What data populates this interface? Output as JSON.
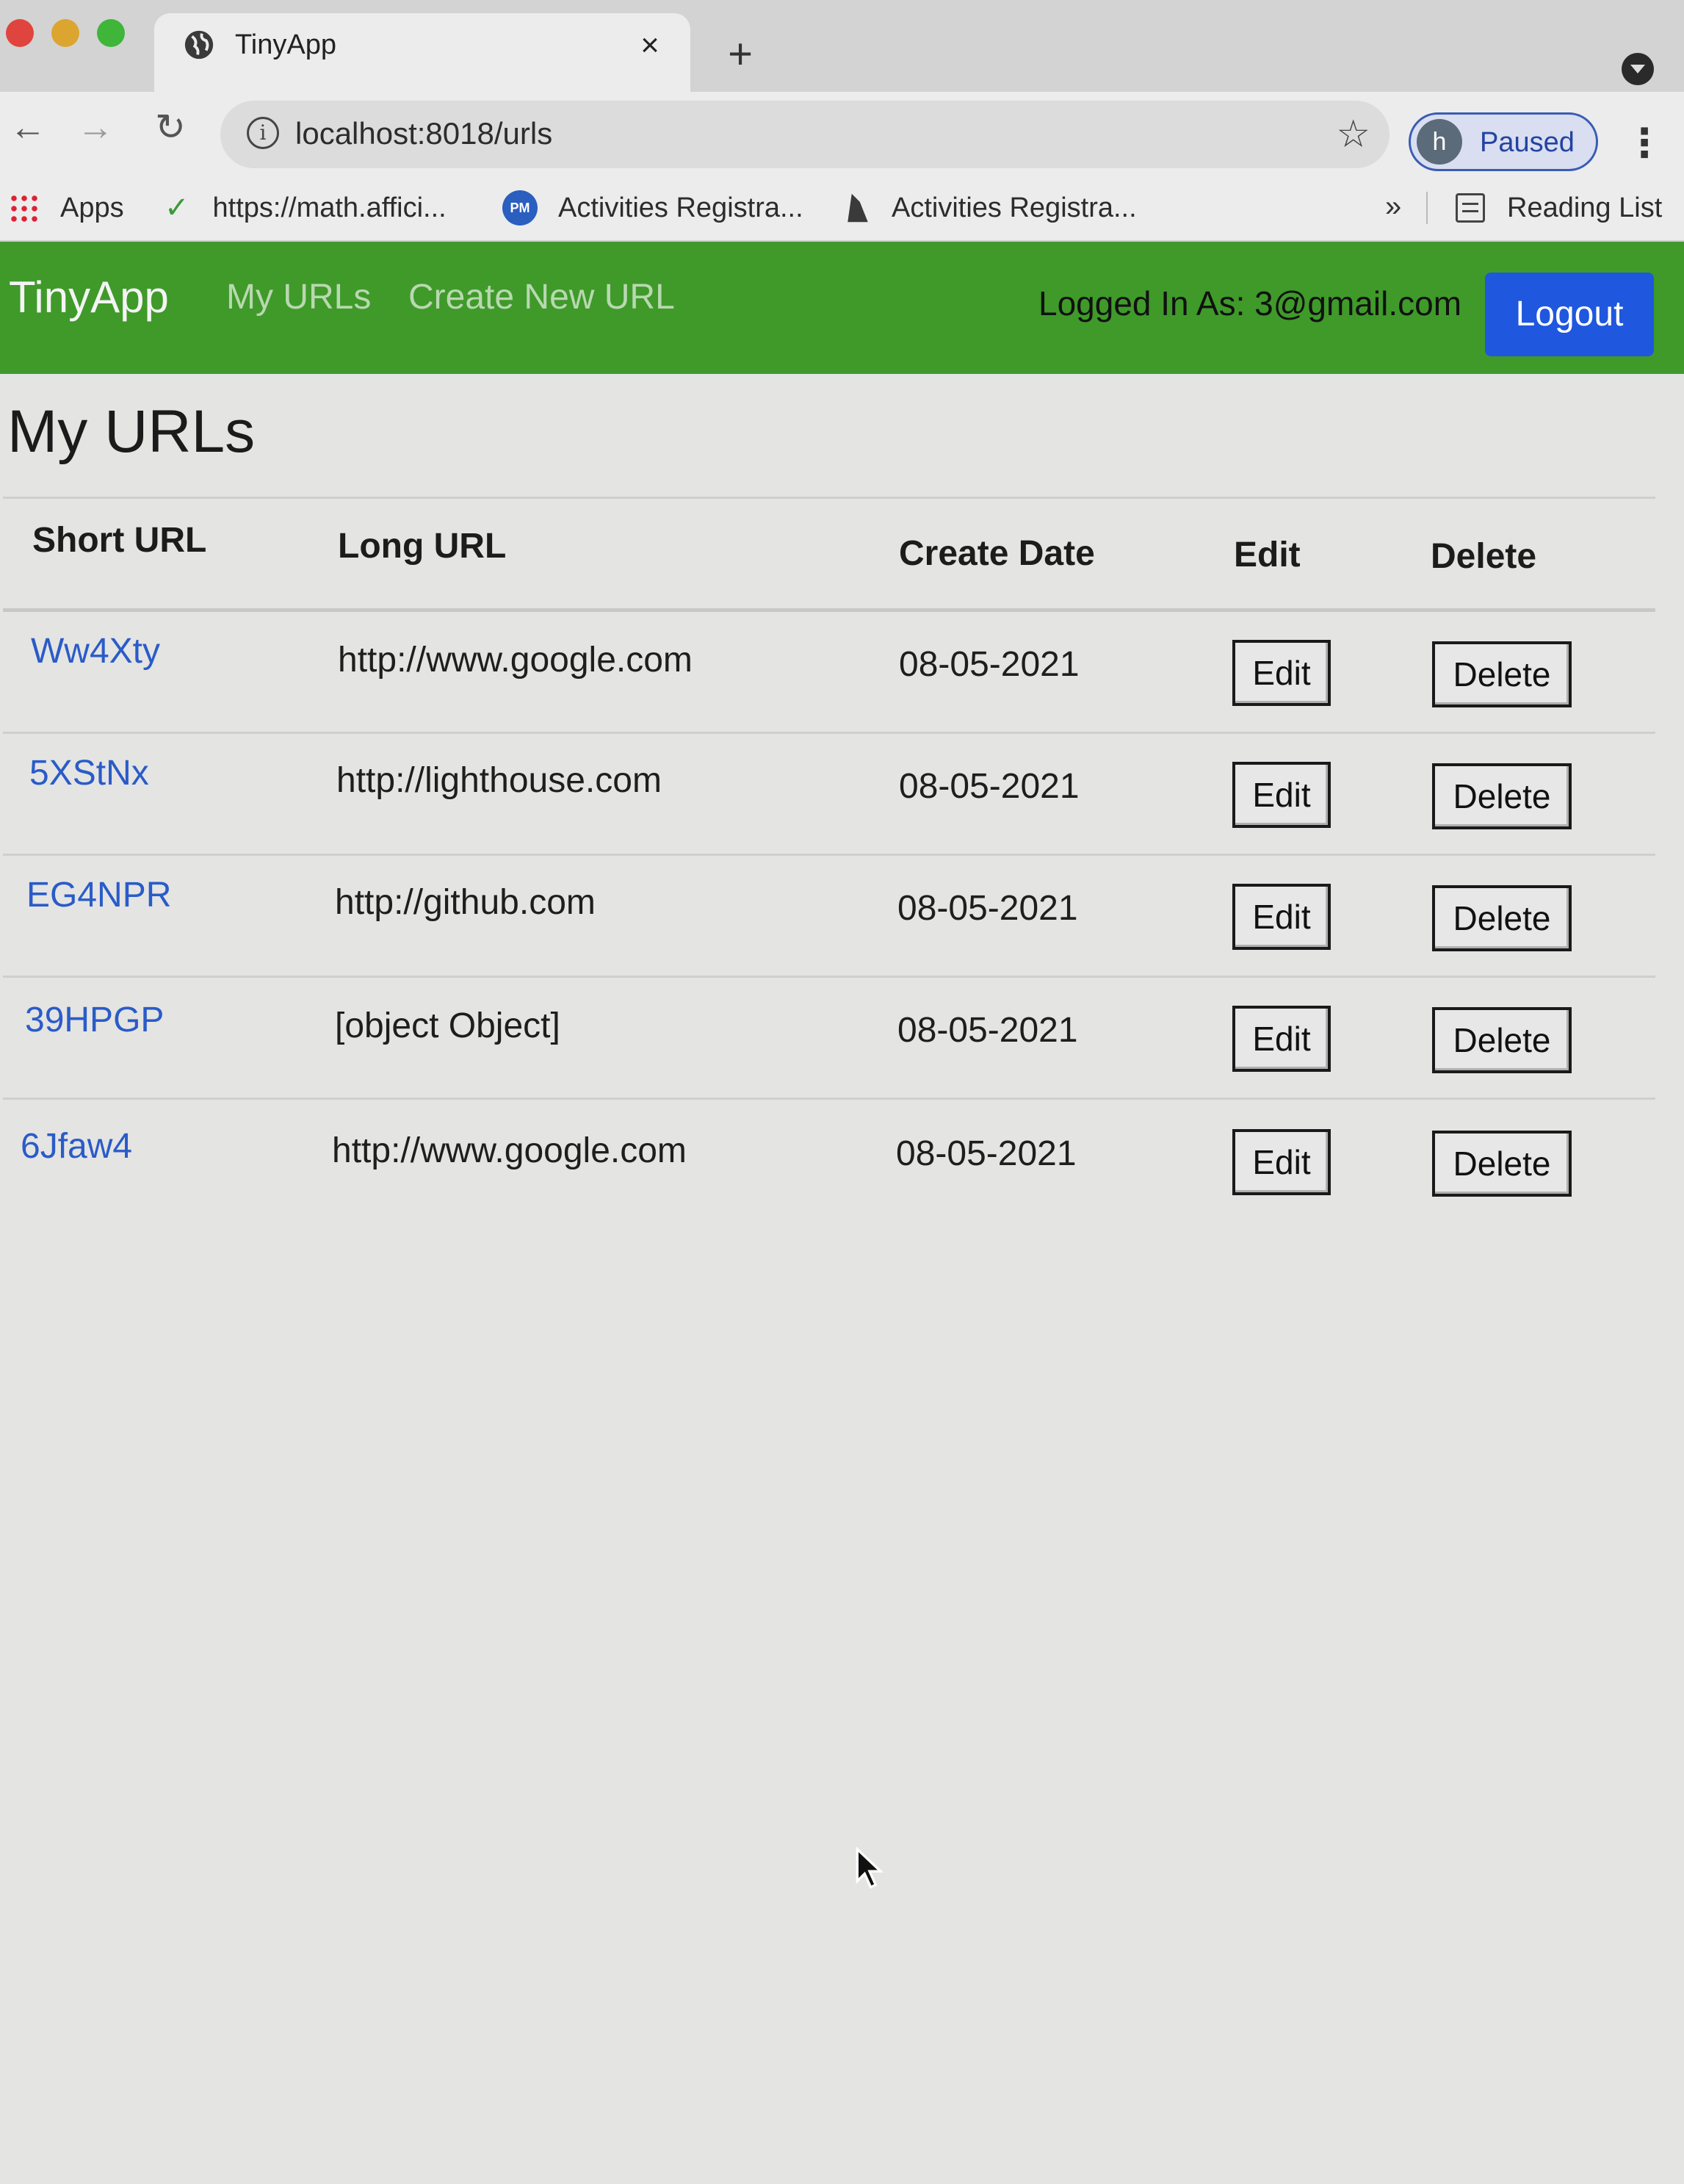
{
  "browser": {
    "tab_title": "TinyApp",
    "tab_close": "×",
    "new_tab": "+",
    "url": "localhost:8018/urls",
    "profile_initial": "h",
    "profile_status": "Paused",
    "bookmarks": [
      {
        "label": "Apps",
        "icon": "apps-grid-icon"
      },
      {
        "label": "https://math.affici...",
        "icon": "check-icon"
      },
      {
        "label": "Activities Registra...",
        "icon": "pm-icon"
      },
      {
        "label": "Activities Registra...",
        "icon": "document-icon"
      }
    ],
    "more_bookmarks": "»",
    "reading_list": "Reading List"
  },
  "navbar": {
    "brand": "TinyApp",
    "my_urls": "My URLs",
    "create_new_url": "Create New URL",
    "logged_in_as": "Logged In As: 3@gmail.com",
    "logout": "Logout",
    "background_color": "#3f9a2a"
  },
  "main": {
    "title": "My URLs",
    "headers": {
      "short_url": "Short URL",
      "long_url": "Long URL",
      "create_date": "Create Date",
      "edit": "Edit",
      "delete": "Delete"
    },
    "rows": [
      {
        "short_url": "Ww4Xty",
        "long_url": "http://www.google.com",
        "create_date": "08-05-2021",
        "edit": "Edit",
        "delete": "Delete"
      },
      {
        "short_url": "5XStNx",
        "long_url": "http://lighthouse.com",
        "create_date": "08-05-2021",
        "edit": "Edit",
        "delete": "Delete"
      },
      {
        "short_url": "EG4NPR",
        "long_url": "http://github.com",
        "create_date": "08-05-2021",
        "edit": "Edit",
        "delete": "Delete"
      },
      {
        "short_url": "39HPGP",
        "long_url": "[object Object]",
        "create_date": "08-05-2021",
        "edit": "Edit",
        "delete": "Delete"
      },
      {
        "short_url": "6Jfaw4",
        "long_url": "http://www.google.com",
        "create_date": "08-05-2021",
        "edit": "Edit",
        "delete": "Delete"
      }
    ]
  }
}
